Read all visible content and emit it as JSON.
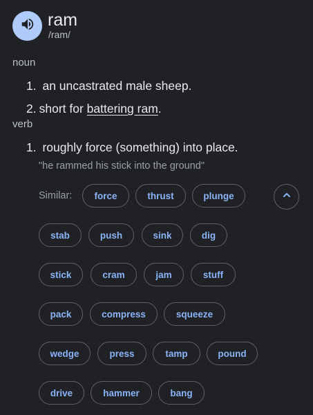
{
  "entry": {
    "word": "ram",
    "pronunciation": "/ram/",
    "speaker_icon": "volume-up-icon"
  },
  "noun": {
    "label": "noun",
    "definitions": [
      {
        "number": "1.",
        "text": "an uncastrated male sheep."
      },
      {
        "number": "2.",
        "prefix": "short for ",
        "link_text": "battering ram",
        "suffix": "."
      }
    ]
  },
  "verb": {
    "label": "verb",
    "definitions": [
      {
        "number": "1.",
        "text": "roughly force (something) into place.",
        "example": "\"he rammed his stick into the ground\""
      }
    ]
  },
  "similar": {
    "label": "Similar:",
    "collapse_icon": "chevron-up-icon",
    "words": [
      "force",
      "thrust",
      "plunge",
      "stab",
      "push",
      "sink",
      "dig",
      "stick",
      "cram",
      "jam",
      "stuff",
      "pack",
      "compress",
      "squeeze",
      "wedge",
      "press",
      "tamp",
      "pound",
      "drive",
      "hammer",
      "bang"
    ]
  },
  "colors": {
    "background": "#202124",
    "text": "#e8eaed",
    "muted": "#9aa0a6",
    "chip_text": "#8ab4f8",
    "chip_border": "#5f6368",
    "speaker_bg": "#aecbfa"
  }
}
